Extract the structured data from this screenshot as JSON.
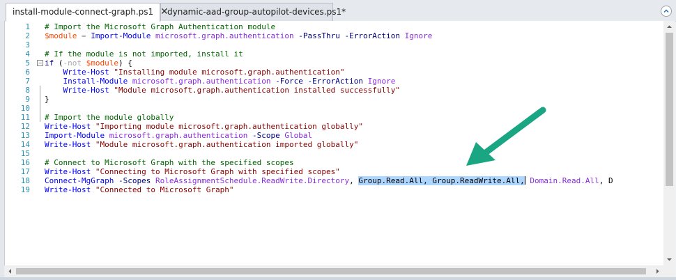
{
  "tabs": [
    {
      "label": "install-module-connect-graph.ps1",
      "active": true,
      "close_glyph": "✕"
    },
    {
      "label": "dynamic-aad-group-autopilot-devices.ps1*",
      "active": false
    }
  ],
  "icons": {
    "close": "close-icon",
    "collapse": "chevron-up-icon",
    "fold": "fold-minus-icon",
    "annotation": "arrow-annotation"
  },
  "colors": {
    "annotation_arrow": "#1aa583",
    "selection": "#add6ff",
    "comment": "#006400",
    "string": "#8b0000",
    "command": "#0000ff",
    "argument": "#8a2be2",
    "variable": "#ff4500",
    "parameter": "#000080"
  },
  "editor": {
    "lines": [
      {
        "n": "1",
        "tokens": [
          [
            "cmt",
            "# Import the Microsoft Graph Authentication module"
          ]
        ]
      },
      {
        "n": "2",
        "tokens": [
          [
            "var",
            "$module"
          ],
          [
            "op",
            " = "
          ],
          [
            "cmd",
            "Import-Module"
          ],
          [
            "txt",
            " "
          ],
          [
            "arg",
            "microsoft.graph.authentication"
          ],
          [
            "txt",
            " "
          ],
          [
            "prm",
            "-PassThru"
          ],
          [
            "txt",
            " "
          ],
          [
            "prm",
            "-ErrorAction"
          ],
          [
            "txt",
            " "
          ],
          [
            "arg",
            "Ignore"
          ]
        ]
      },
      {
        "n": "3",
        "tokens": []
      },
      {
        "n": "4",
        "tokens": [
          [
            "cmt",
            "# If the module is not imported, install it"
          ]
        ]
      },
      {
        "n": "5",
        "fold": true,
        "tokens": [
          [
            "kw",
            "if"
          ],
          [
            "grp",
            " ("
          ],
          [
            "op",
            "-not"
          ],
          [
            "txt",
            " "
          ],
          [
            "var",
            "$module"
          ],
          [
            "grp",
            ") {"
          ]
        ]
      },
      {
        "n": "6",
        "tokens": [
          [
            "txt",
            "    "
          ],
          [
            "cmd",
            "Write-Host"
          ],
          [
            "txt",
            " "
          ],
          [
            "str",
            "\"Installing module microsoft.graph.authentication\""
          ]
        ]
      },
      {
        "n": "7",
        "tokens": [
          [
            "txt",
            "    "
          ],
          [
            "cmd",
            "Install-Module"
          ],
          [
            "txt",
            " "
          ],
          [
            "arg",
            "microsoft.graph.authentication"
          ],
          [
            "txt",
            " "
          ],
          [
            "prm",
            "-Force"
          ],
          [
            "txt",
            " "
          ],
          [
            "prm",
            "-ErrorAction"
          ],
          [
            "txt",
            " "
          ],
          [
            "arg",
            "Ignore"
          ]
        ]
      },
      {
        "n": "8",
        "tokens": [
          [
            "txt",
            "    "
          ],
          [
            "cmd",
            "Write-Host"
          ],
          [
            "txt",
            " "
          ],
          [
            "str",
            "\"Module microsoft.graph.authentication installed successfully\""
          ]
        ]
      },
      {
        "n": "9",
        "tokens": [
          [
            "grp",
            "}"
          ]
        ]
      },
      {
        "n": "10",
        "tokens": []
      },
      {
        "n": "11",
        "tokens": [
          [
            "cmt",
            "# Import the module globally"
          ]
        ]
      },
      {
        "n": "12",
        "tokens": [
          [
            "cmd",
            "Write-Host"
          ],
          [
            "txt",
            " "
          ],
          [
            "str",
            "\"Importing module microsoft.graph.authentication globally\""
          ]
        ]
      },
      {
        "n": "13",
        "tokens": [
          [
            "cmd",
            "Import-Module"
          ],
          [
            "txt",
            " "
          ],
          [
            "arg",
            "microsoft.graph.authentication"
          ],
          [
            "txt",
            " "
          ],
          [
            "prm",
            "-Scope"
          ],
          [
            "txt",
            " "
          ],
          [
            "arg",
            "Global"
          ]
        ]
      },
      {
        "n": "14",
        "tokens": [
          [
            "cmd",
            "Write-Host"
          ],
          [
            "txt",
            " "
          ],
          [
            "str",
            "\"Module microsoft.graph.authentication imported globally\""
          ]
        ]
      },
      {
        "n": "15",
        "tokens": []
      },
      {
        "n": "16",
        "tokens": [
          [
            "cmt",
            "# Connect to Microsoft Graph with the specified scopes"
          ]
        ]
      },
      {
        "n": "17",
        "tokens": [
          [
            "cmd",
            "Write-Host"
          ],
          [
            "txt",
            " "
          ],
          [
            "str",
            "\"Connecting to Microsoft Graph with specified scopes\""
          ]
        ]
      },
      {
        "n": "18",
        "tokens": [
          [
            "cmd",
            "Connect-MgGraph"
          ],
          [
            "txt",
            " "
          ],
          [
            "prm",
            "-Scopes"
          ],
          [
            "txt",
            " "
          ],
          [
            "arg",
            "RoleAssignmentSchedule.ReadWrite.Directory"
          ],
          [
            "grp",
            ", "
          ],
          [
            "sel",
            "Group.Read.All, Group.ReadWrite.All,"
          ],
          [
            "caret",
            ""
          ],
          [
            "txt",
            " "
          ],
          [
            "arg",
            "Domain.Read.All"
          ],
          [
            "grp",
            ", D"
          ]
        ]
      },
      {
        "n": "19",
        "tokens": [
          [
            "cmd",
            "Write-Host"
          ],
          [
            "txt",
            " "
          ],
          [
            "str",
            "\"Connected to Microsoft Graph\""
          ]
        ]
      }
    ]
  }
}
